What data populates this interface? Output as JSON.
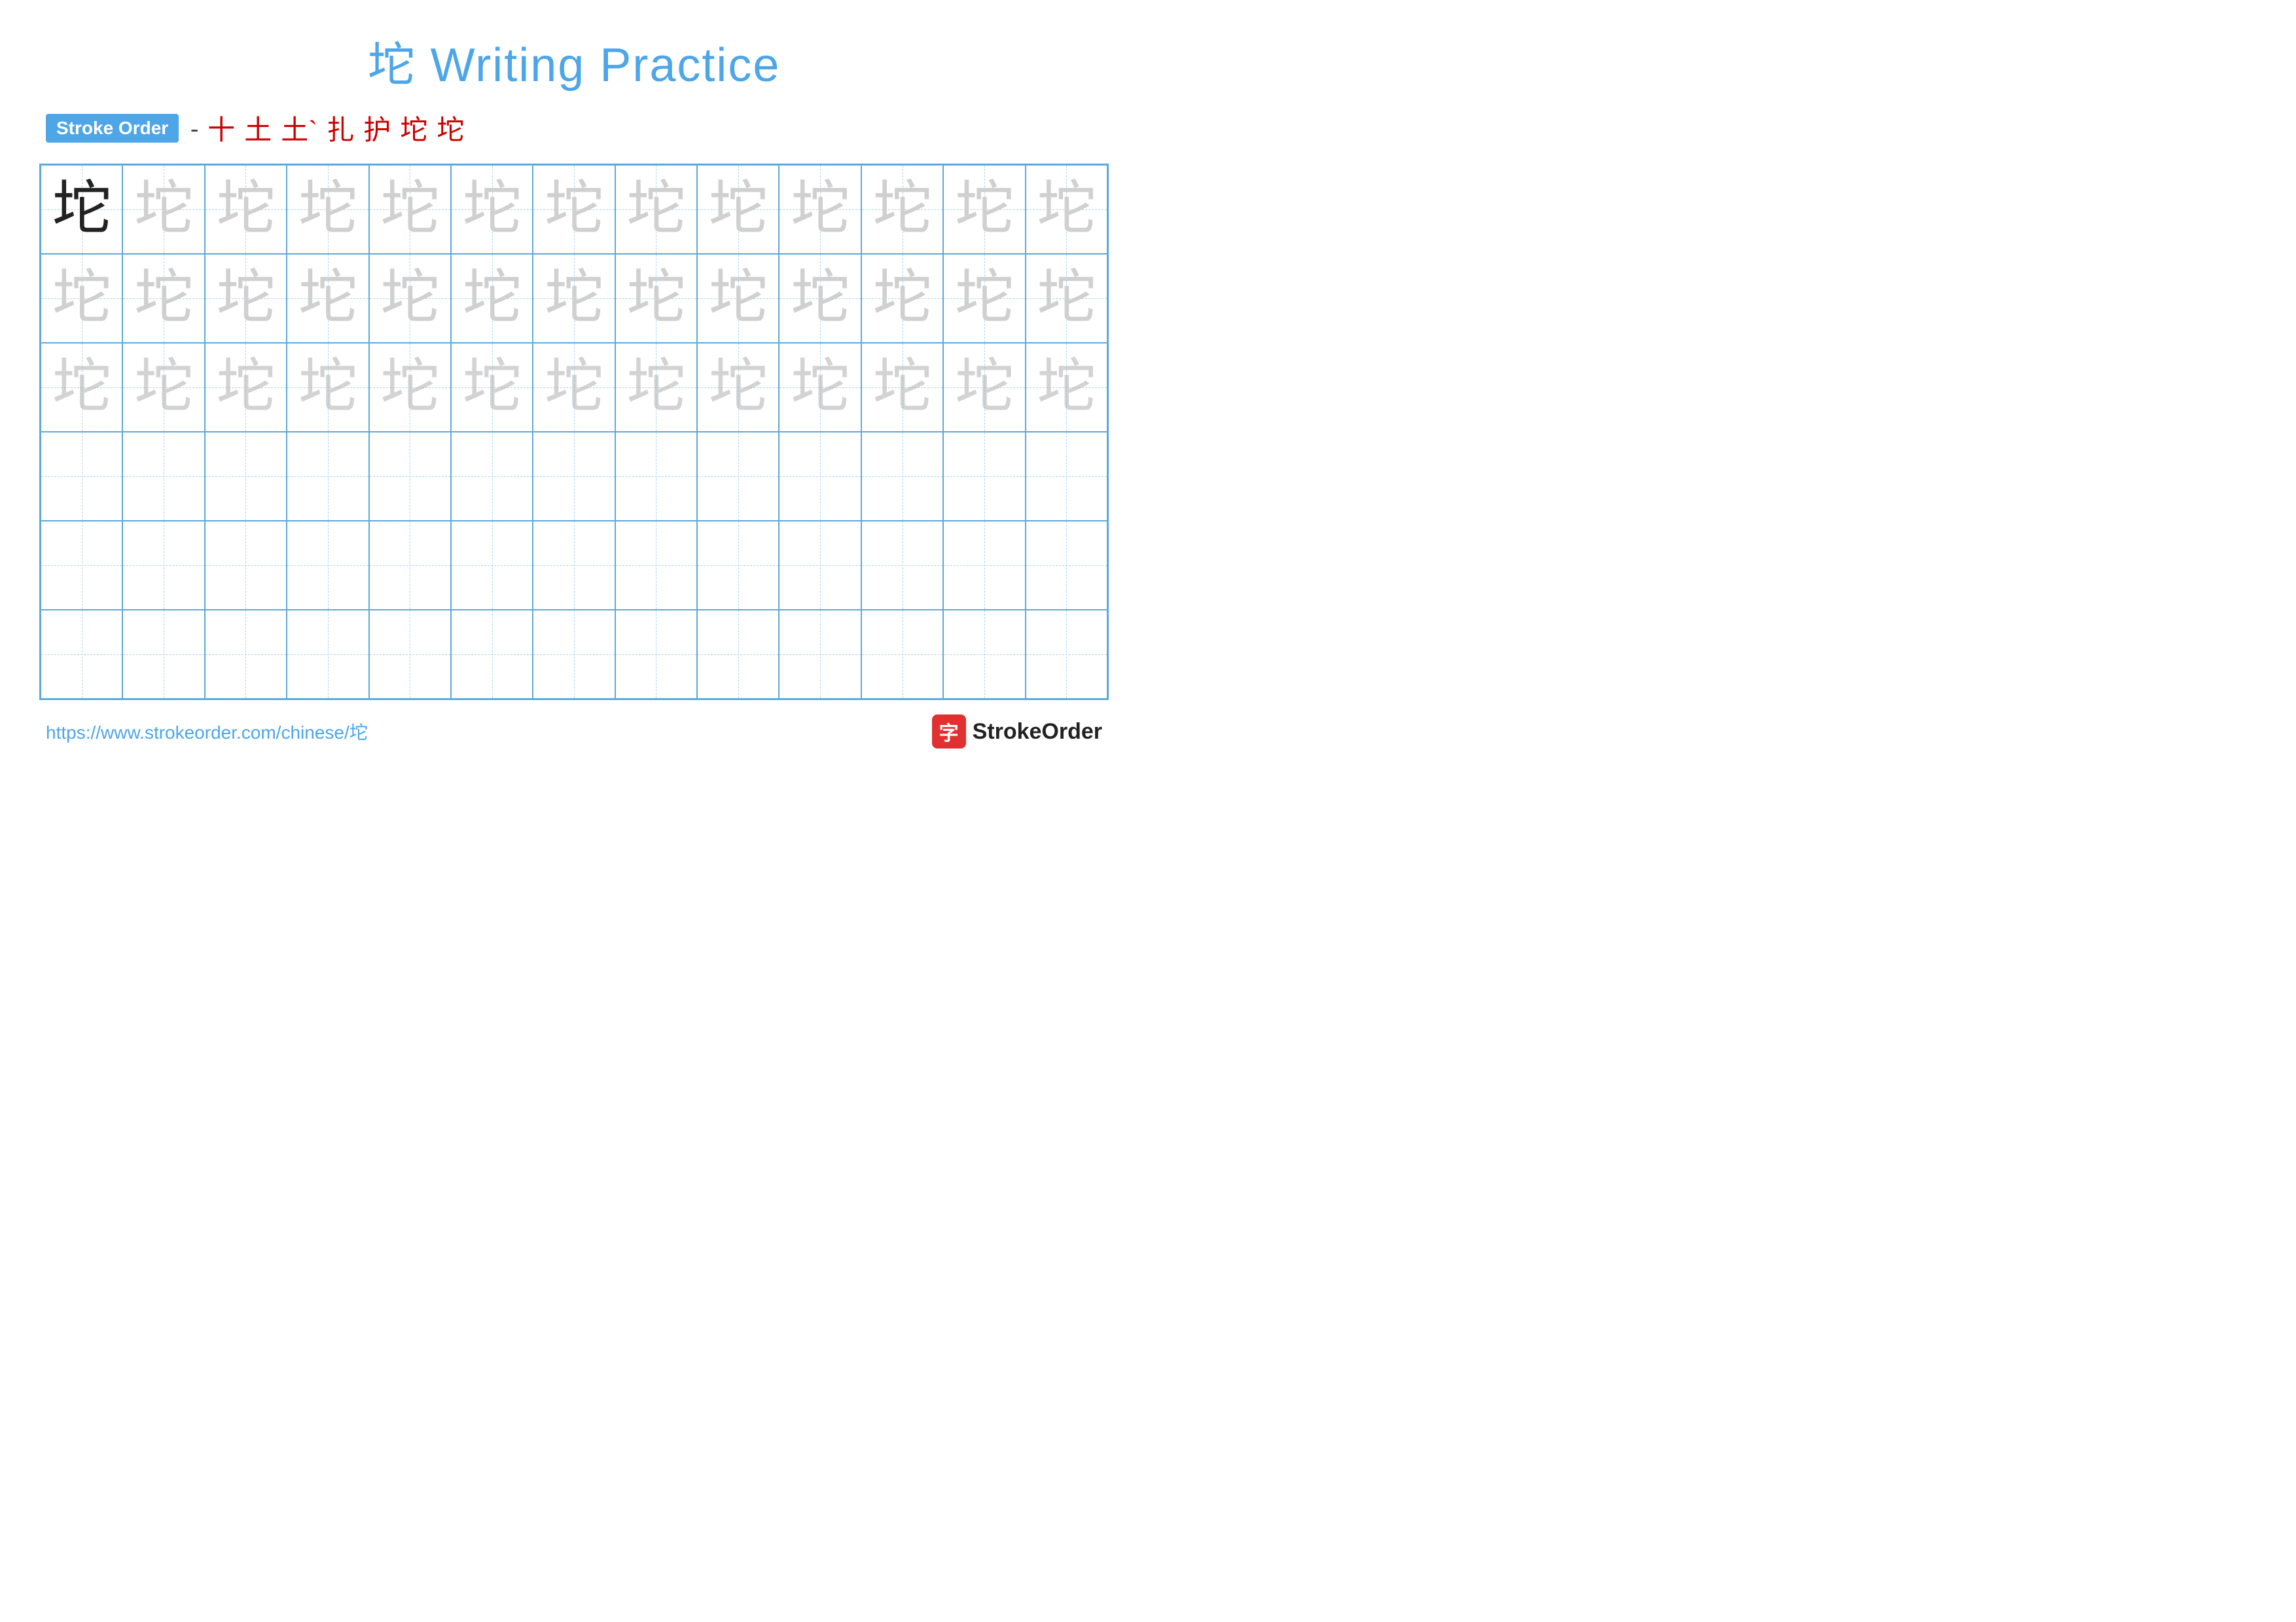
{
  "title": "坨 Writing Practice",
  "stroke_order": {
    "badge_label": "Stroke Order",
    "strokes": [
      "一",
      "十",
      "土",
      "土`",
      "扎",
      "护",
      "坨",
      "坨"
    ]
  },
  "character": "坨",
  "grid": {
    "rows": 6,
    "cols": 13
  },
  "footer": {
    "url": "https://www.strokeorder.com/chinese/坨",
    "logo_char": "字",
    "logo_name": "StrokeOrder"
  }
}
